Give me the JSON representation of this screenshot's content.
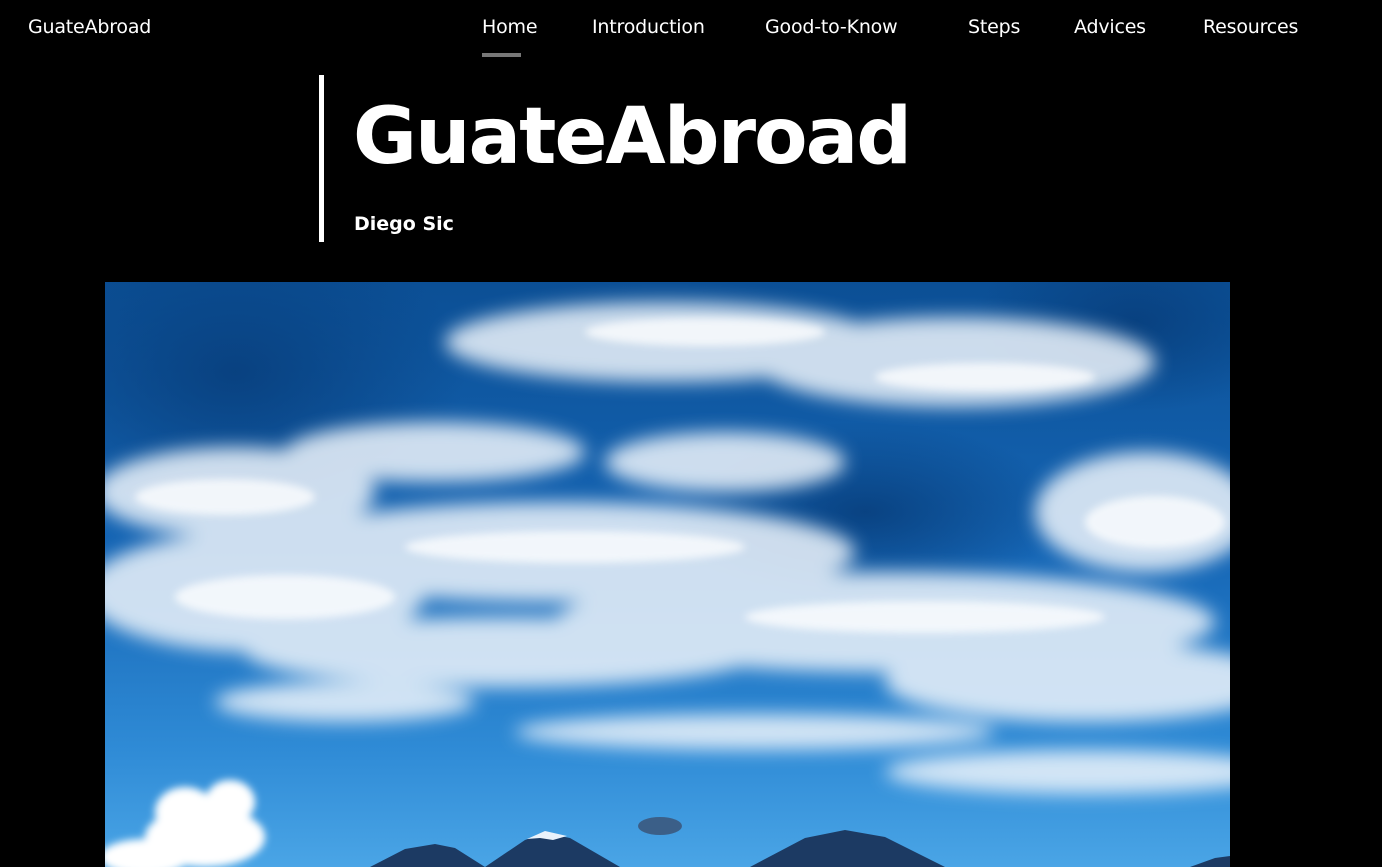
{
  "header": {
    "site_name": "GuateAbroad"
  },
  "nav": {
    "items": [
      {
        "label": "Home",
        "active": true
      },
      {
        "label": "Introduction",
        "active": false
      },
      {
        "label": "Good-to-Know",
        "active": false
      },
      {
        "label": "Steps",
        "active": false
      },
      {
        "label": "Advices",
        "active": false
      },
      {
        "label": "Resources",
        "active": false
      }
    ]
  },
  "hero": {
    "title": "GuateAbroad",
    "author": "Diego Sic",
    "image": "sky-volcanoes-photo"
  },
  "colors": {
    "background": "#000000",
    "text": "#ffffff",
    "active_underline": "#777777",
    "sky_deep": "#0b4f95",
    "sky_light": "#3a98de",
    "cloud": "#f2f6fb",
    "volcano": "#1c3a63"
  }
}
